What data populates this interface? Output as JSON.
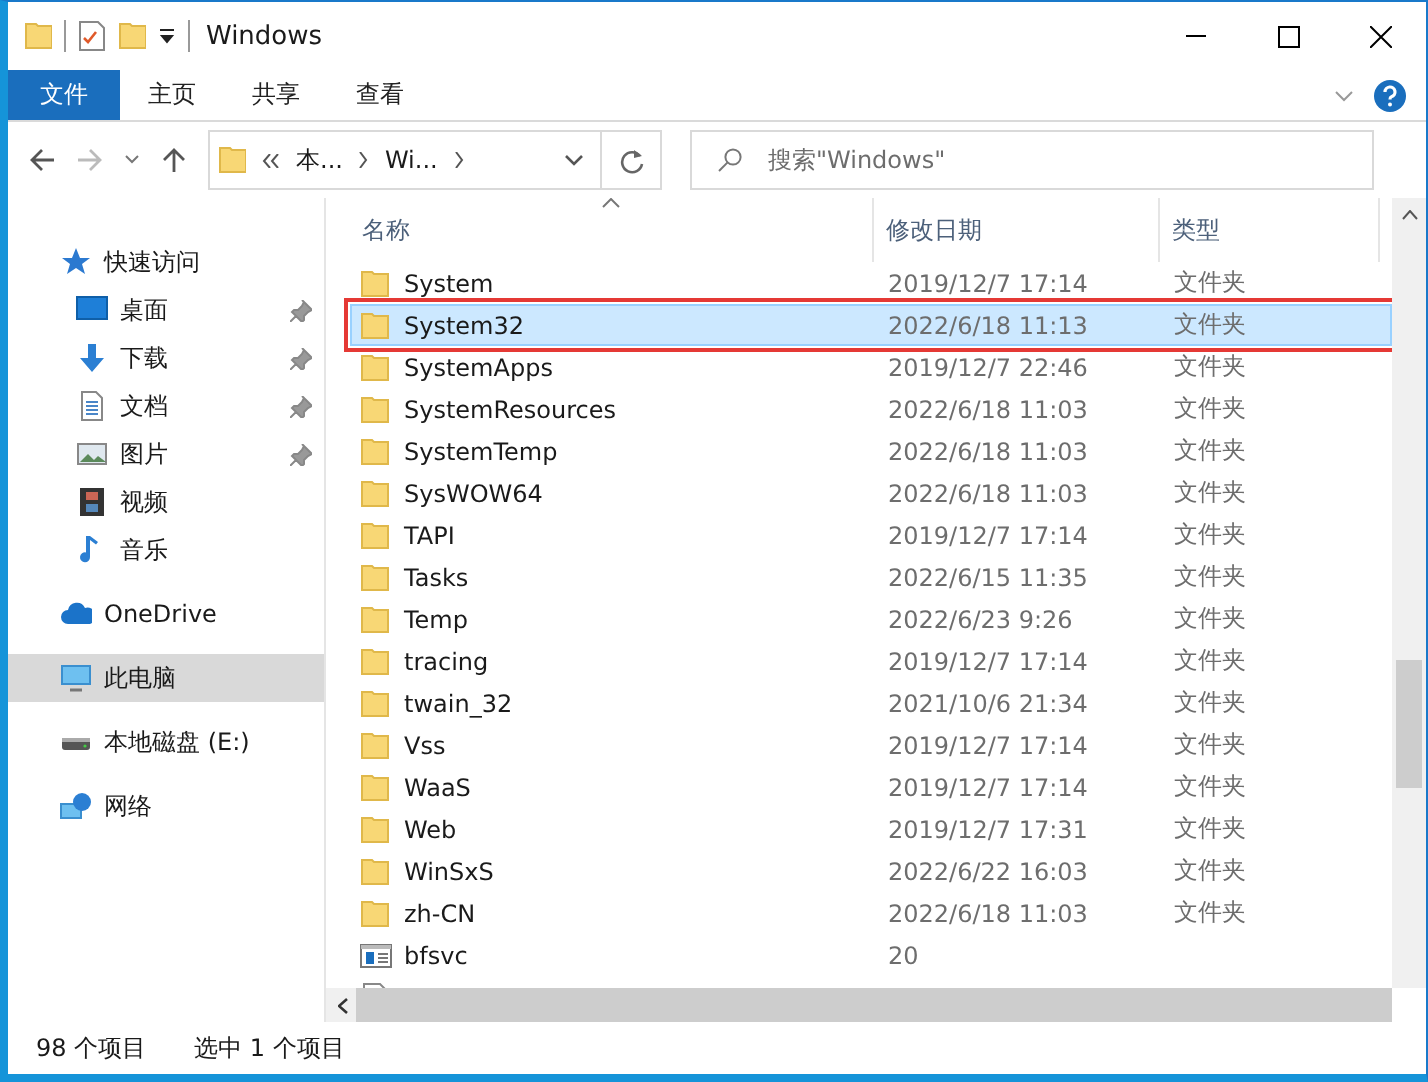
{
  "window": {
    "title": "Windows"
  },
  "ribbon_tabs": [
    {
      "label": "文件",
      "kind": "file"
    },
    {
      "label": "主页",
      "kind": "tab"
    },
    {
      "label": "共享",
      "kind": "tab"
    },
    {
      "label": "查看",
      "kind": "tab"
    }
  ],
  "address_bar": {
    "crumbs": [
      "本...",
      "Wi..."
    ]
  },
  "search": {
    "placeholder": "搜索\"Windows\""
  },
  "sidebar": {
    "items": [
      {
        "label": "快速访问",
        "kind": "star",
        "selected": false,
        "children": [
          {
            "label": "桌面",
            "kind": "desktop",
            "pinned": true
          },
          {
            "label": "下载",
            "kind": "download",
            "pinned": true
          },
          {
            "label": "文档",
            "kind": "document",
            "pinned": true
          },
          {
            "label": "图片",
            "kind": "pictures",
            "pinned": true
          },
          {
            "label": "视频",
            "kind": "video",
            "pinned": false
          },
          {
            "label": "音乐",
            "kind": "music",
            "pinned": false
          }
        ]
      },
      {
        "label": "OneDrive",
        "kind": "cloud",
        "selected": false
      },
      {
        "label": "此电脑",
        "kind": "pc",
        "selected": true
      },
      {
        "label": "本地磁盘 (E:)",
        "kind": "drive",
        "selected": false
      },
      {
        "label": "网络",
        "kind": "network",
        "selected": false
      }
    ]
  },
  "table": {
    "columns": [
      "名称",
      "修改日期",
      "类型"
    ],
    "rows": [
      {
        "name": "System",
        "date": "2019/12/7 17:14",
        "type": "文件夹",
        "kind": "folder",
        "selected": false,
        "annotated": false
      },
      {
        "name": "System32",
        "date": "2022/6/18 11:13",
        "type": "文件夹",
        "kind": "folder",
        "selected": true,
        "annotated": true
      },
      {
        "name": "SystemApps",
        "date": "2019/12/7 22:46",
        "type": "文件夹",
        "kind": "folder",
        "selected": false,
        "annotated": false
      },
      {
        "name": "SystemResources",
        "date": "2022/6/18 11:03",
        "type": "文件夹",
        "kind": "folder",
        "selected": false,
        "annotated": false
      },
      {
        "name": "SystemTemp",
        "date": "2022/6/18 11:03",
        "type": "文件夹",
        "kind": "folder",
        "selected": false,
        "annotated": false
      },
      {
        "name": "SysWOW64",
        "date": "2022/6/18 11:03",
        "type": "文件夹",
        "kind": "folder",
        "selected": false,
        "annotated": false
      },
      {
        "name": "TAPI",
        "date": "2019/12/7 17:14",
        "type": "文件夹",
        "kind": "folder",
        "selected": false,
        "annotated": false
      },
      {
        "name": "Tasks",
        "date": "2022/6/15 11:35",
        "type": "文件夹",
        "kind": "folder",
        "selected": false,
        "annotated": false
      },
      {
        "name": "Temp",
        "date": "2022/6/23 9:26",
        "type": "文件夹",
        "kind": "folder",
        "selected": false,
        "annotated": false
      },
      {
        "name": "tracing",
        "date": "2019/12/7 17:14",
        "type": "文件夹",
        "kind": "folder",
        "selected": false,
        "annotated": false
      },
      {
        "name": "twain_32",
        "date": "2021/10/6 21:34",
        "type": "文件夹",
        "kind": "folder",
        "selected": false,
        "annotated": false
      },
      {
        "name": "Vss",
        "date": "2019/12/7 17:14",
        "type": "文件夹",
        "kind": "folder",
        "selected": false,
        "annotated": false
      },
      {
        "name": "WaaS",
        "date": "2019/12/7 17:14",
        "type": "文件夹",
        "kind": "folder",
        "selected": false,
        "annotated": false
      },
      {
        "name": "Web",
        "date": "2019/12/7 17:31",
        "type": "文件夹",
        "kind": "folder",
        "selected": false,
        "annotated": false
      },
      {
        "name": "WinSxS",
        "date": "2022/6/22 16:03",
        "type": "文件夹",
        "kind": "folder",
        "selected": false,
        "annotated": false
      },
      {
        "name": "zh-CN",
        "date": "2022/6/18 11:03",
        "type": "文件夹",
        "kind": "folder",
        "selected": false,
        "annotated": false
      },
      {
        "name": "bfsvc",
        "date": "20",
        "kind": "app",
        "selected": false,
        "annotated": false
      },
      {
        "kind": "file",
        "selected": false,
        "annotated": false
      }
    ]
  },
  "status_bar": [
    "98 个项目",
    "选中 1 个项目"
  ]
}
